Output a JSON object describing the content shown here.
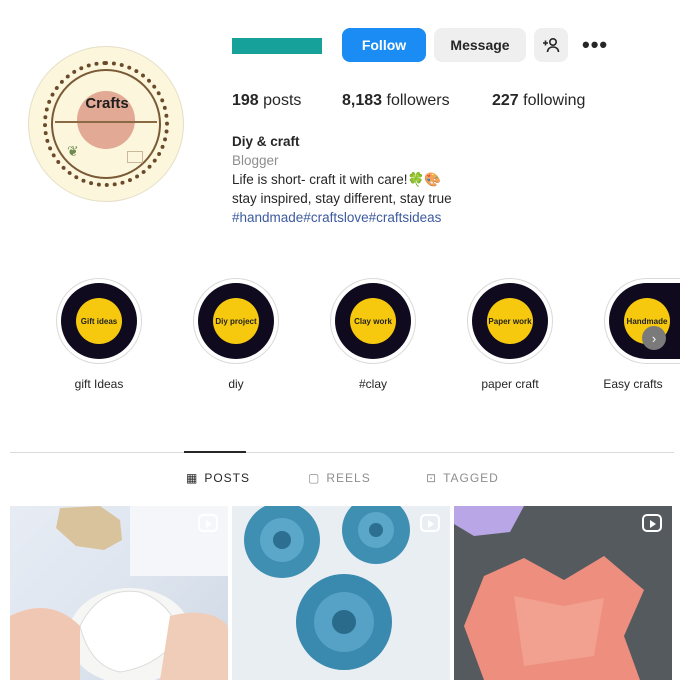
{
  "profile": {
    "avatar_text": "Crafts",
    "name": "Diy & craft",
    "category": "Blogger",
    "bio_line1": "Life is short- craft it with care!🍀🎨",
    "bio_line2": "stay inspired, stay different, stay true",
    "hashtags": "#handmade#craftslove#craftsideas"
  },
  "actions": {
    "follow": "Follow",
    "message": "Message",
    "add_user_icon": "add-user-icon",
    "more_icon": "more-options-icon"
  },
  "stats": {
    "posts_count": "198",
    "posts_label": "posts",
    "followers_count": "8,183",
    "followers_label": "followers",
    "following_count": "227",
    "following_label": "following"
  },
  "highlights": [
    {
      "badge": "Gift ideas",
      "label": "gift Ideas"
    },
    {
      "badge": "Diy project",
      "label": "diy"
    },
    {
      "badge": "Clay work",
      "label": "#clay"
    },
    {
      "badge": "Paper work",
      "label": "paper craft"
    },
    {
      "badge": "Handmade",
      "label": "Easy crafts"
    }
  ],
  "tabs": {
    "posts": "POSTS",
    "reels": "REELS",
    "tagged": "TAGGED"
  },
  "colors": {
    "accent": "#1a8cf3",
    "highlight_yellow": "#f6c90e",
    "highlight_dark": "#0f0a1d",
    "hashtag": "#3d5a9f"
  }
}
